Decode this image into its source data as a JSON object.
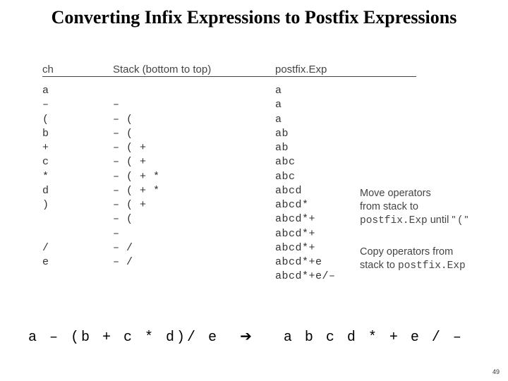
{
  "title": "Converting Infix Expressions to Postfix Expressions",
  "headers": {
    "ch": "ch",
    "stack": "Stack (bottom to top)",
    "postfix": "postfix.Exp"
  },
  "rows": [
    {
      "ch": "a",
      "stack": "",
      "postfix": "a"
    },
    {
      "ch": "–",
      "stack": "–",
      "postfix": "a"
    },
    {
      "ch": "(",
      "stack": "– (",
      "postfix": "a"
    },
    {
      "ch": "b",
      "stack": "– (",
      "postfix": "ab"
    },
    {
      "ch": "+",
      "stack": "– ( +",
      "postfix": "ab"
    },
    {
      "ch": "c",
      "stack": "– ( +",
      "postfix": "abc"
    },
    {
      "ch": "*",
      "stack": "– ( + *",
      "postfix": "abc"
    },
    {
      "ch": "d",
      "stack": "– ( + *",
      "postfix": "abcd"
    },
    {
      "ch": ")",
      "stack": "– ( +",
      "postfix": "abcd*"
    },
    {
      "ch": "",
      "stack": "– (",
      "postfix": "abcd*+"
    },
    {
      "ch": "",
      "stack": "–",
      "postfix": "abcd*+"
    },
    {
      "ch": "/",
      "stack": "– /",
      "postfix": "abcd*+"
    },
    {
      "ch": "e",
      "stack": "– /",
      "postfix": "abcd*+e"
    },
    {
      "ch": "",
      "stack": "",
      "postfix": "abcd*+e/–"
    }
  ],
  "annot1": {
    "l1": "Move operators",
    "l2": "from stack to",
    "l3a": "postfix.Exp",
    "l3b": " until \" ( \""
  },
  "annot2": {
    "l1": "Copy operators from",
    "l2a": "stack to ",
    "l2b": "postfix.Exp"
  },
  "bottom": {
    "lhs": "a – (b + c * d)/ e",
    "arrow": "➔",
    "rhs": "a b c d * + e / –"
  },
  "page": "49"
}
